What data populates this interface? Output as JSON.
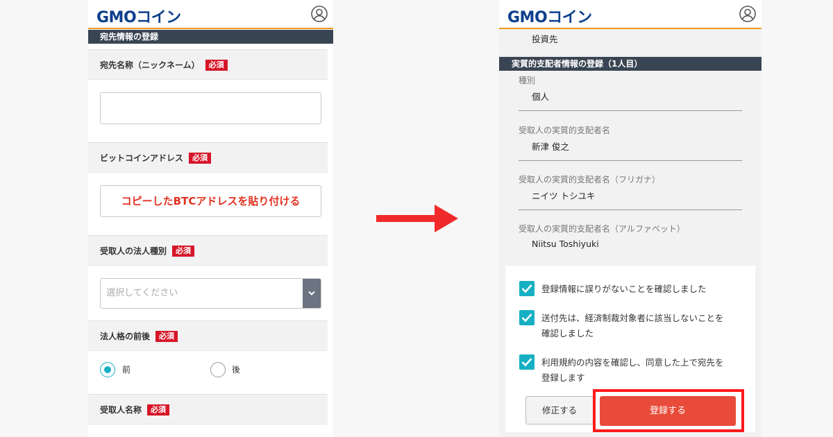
{
  "left": {
    "logo": "GMOコイン",
    "section_title": "宛先情報の登録",
    "required_label": "必須",
    "fields": {
      "nickname": {
        "label": "宛先名称（ニックネーム）"
      },
      "btc_address": {
        "label": "ビットコインアドレス",
        "hint": "コピーしたBTCアドレスを貼り付ける"
      },
      "entity_type": {
        "label": "受取人の法人種別",
        "placeholder": "選択してください"
      },
      "corp_position": {
        "label": "法人格の前後",
        "options": [
          "前",
          "後"
        ],
        "selected": "前"
      },
      "recipient_name": {
        "label": "受取人名称"
      }
    }
  },
  "right": {
    "logo": "GMOコイン",
    "top_value": "投資先",
    "section_title": "実質的支配者情報の登録（1人目）",
    "rows": [
      {
        "label": "種別",
        "value": "個人"
      },
      {
        "label": "受取人の実質的支配者名",
        "value": "新津 俊之"
      },
      {
        "label": "受取人の実質的支配者名（フリガナ）",
        "value": "ニイツ トシユキ"
      },
      {
        "label": "受取人の実質的支配者名（アルファベット）",
        "value": "Niitsu Toshiyuki"
      }
    ],
    "checks": [
      "登録情報に誤りがないことを確認しました",
      "送付先は、経済制裁対象者に該当しないことを確認しました",
      "利用規約の内容を確認し、同意した上で宛先を登録します"
    ],
    "buttons": {
      "fix": "修正する",
      "register": "登録する"
    }
  },
  "colors": {
    "brand": "#0d3f8d",
    "accent": "#f0961e",
    "required": "#d71528",
    "check": "#17b0c2",
    "register": "#e84b3a",
    "highlight": "#ff1a1a",
    "arrow": "#f02a2a"
  }
}
